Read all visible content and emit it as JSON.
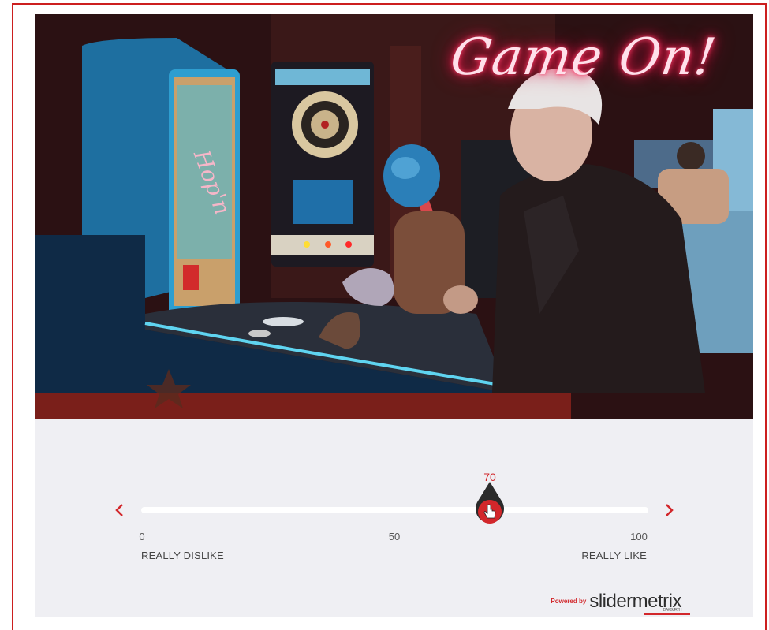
{
  "video": {
    "neon_sign": "Game On!"
  },
  "slider": {
    "value": 70,
    "min": 0,
    "max": 100,
    "value_label": "70",
    "ticks": [
      "0",
      "50",
      "100"
    ],
    "left_label": "REALLY DISLIKE",
    "right_label": "REALLY LIKE",
    "prev_icon": "chevron-left-icon",
    "next_icon": "chevron-right-icon",
    "thumb_icon": "hand-pointer-icon"
  },
  "branding": {
    "powered_by": "Powered by",
    "name": "slidermetrix",
    "sub": "DAKBURTH"
  },
  "colors": {
    "accent": "#d2272b",
    "frame_border": "#cc1f1f",
    "panel_bg": "#efeff3"
  }
}
